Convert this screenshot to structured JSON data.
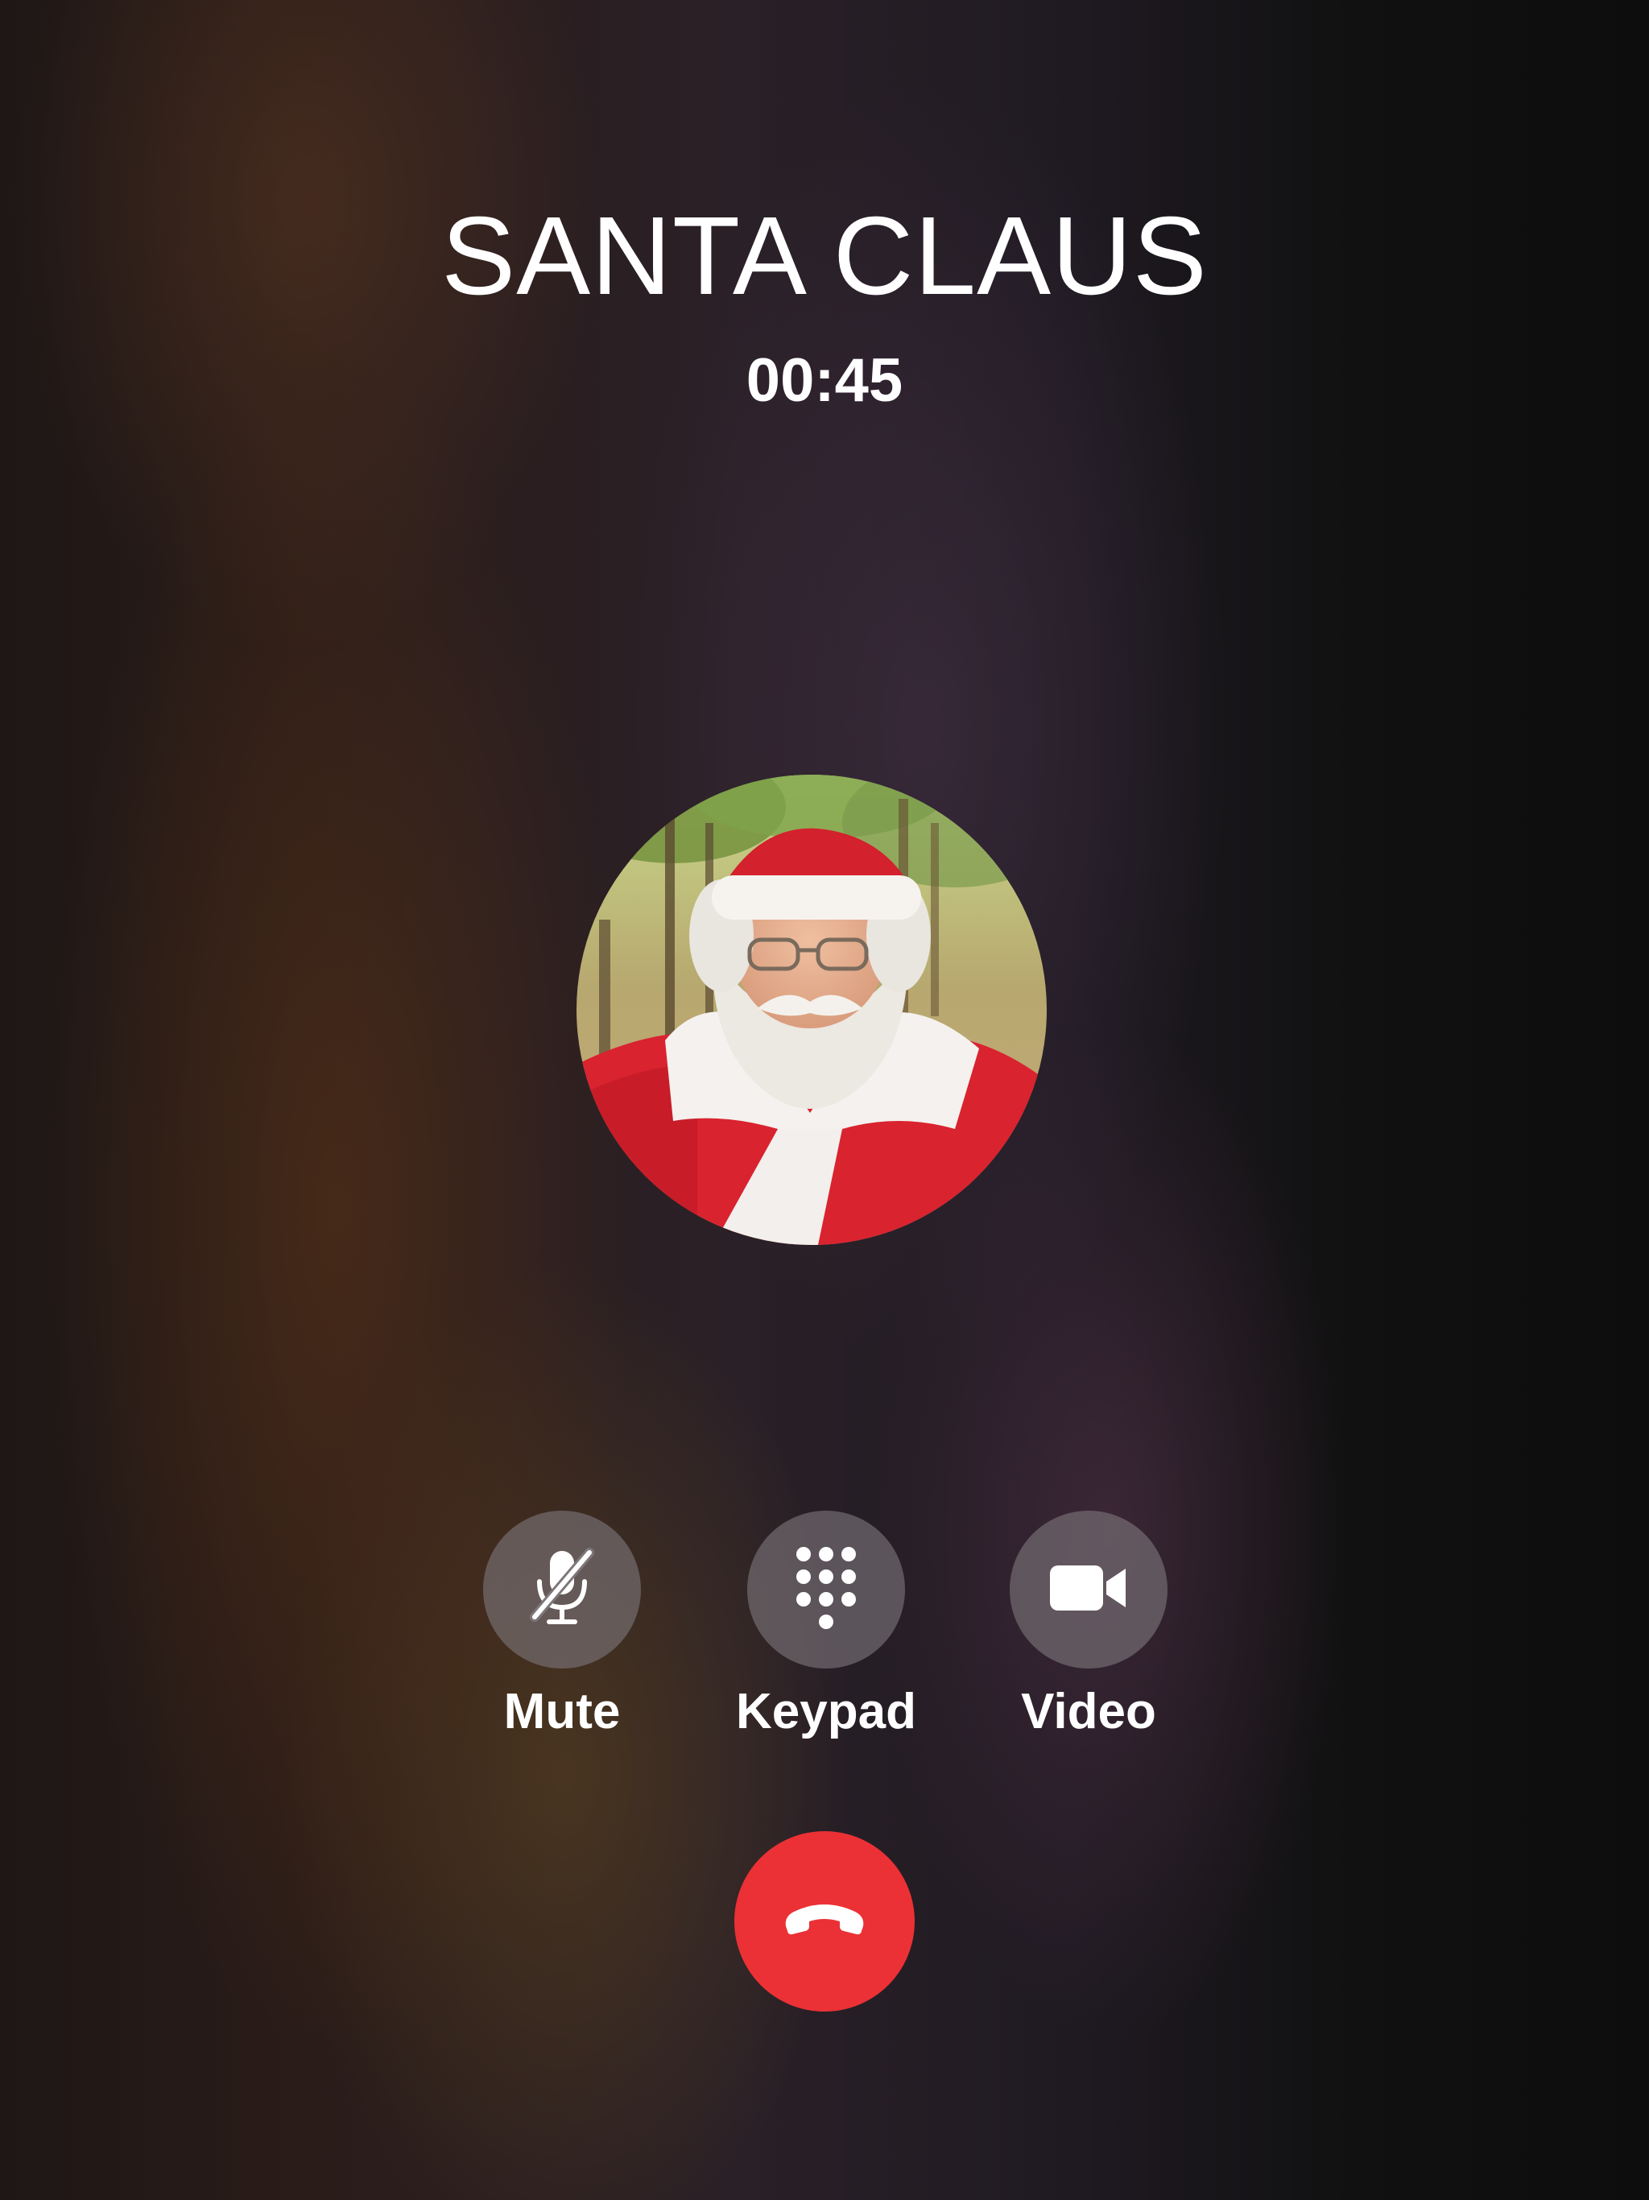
{
  "call": {
    "caller_name": "SANTA CLAUS",
    "duration": "00:45",
    "avatar_icon": "santa-claus-photo"
  },
  "controls": {
    "mute_label": "Mute",
    "mute_icon": "microphone-slash-icon",
    "keypad_label": "Keypad",
    "keypad_icon": "keypad-icon",
    "video_label": "Video",
    "video_icon": "video-camera-icon",
    "end_call_icon": "phone-hangup-icon"
  },
  "colors": {
    "end_call": "#eb3135",
    "control_button": "#7d767a",
    "text": "#ffffff"
  }
}
